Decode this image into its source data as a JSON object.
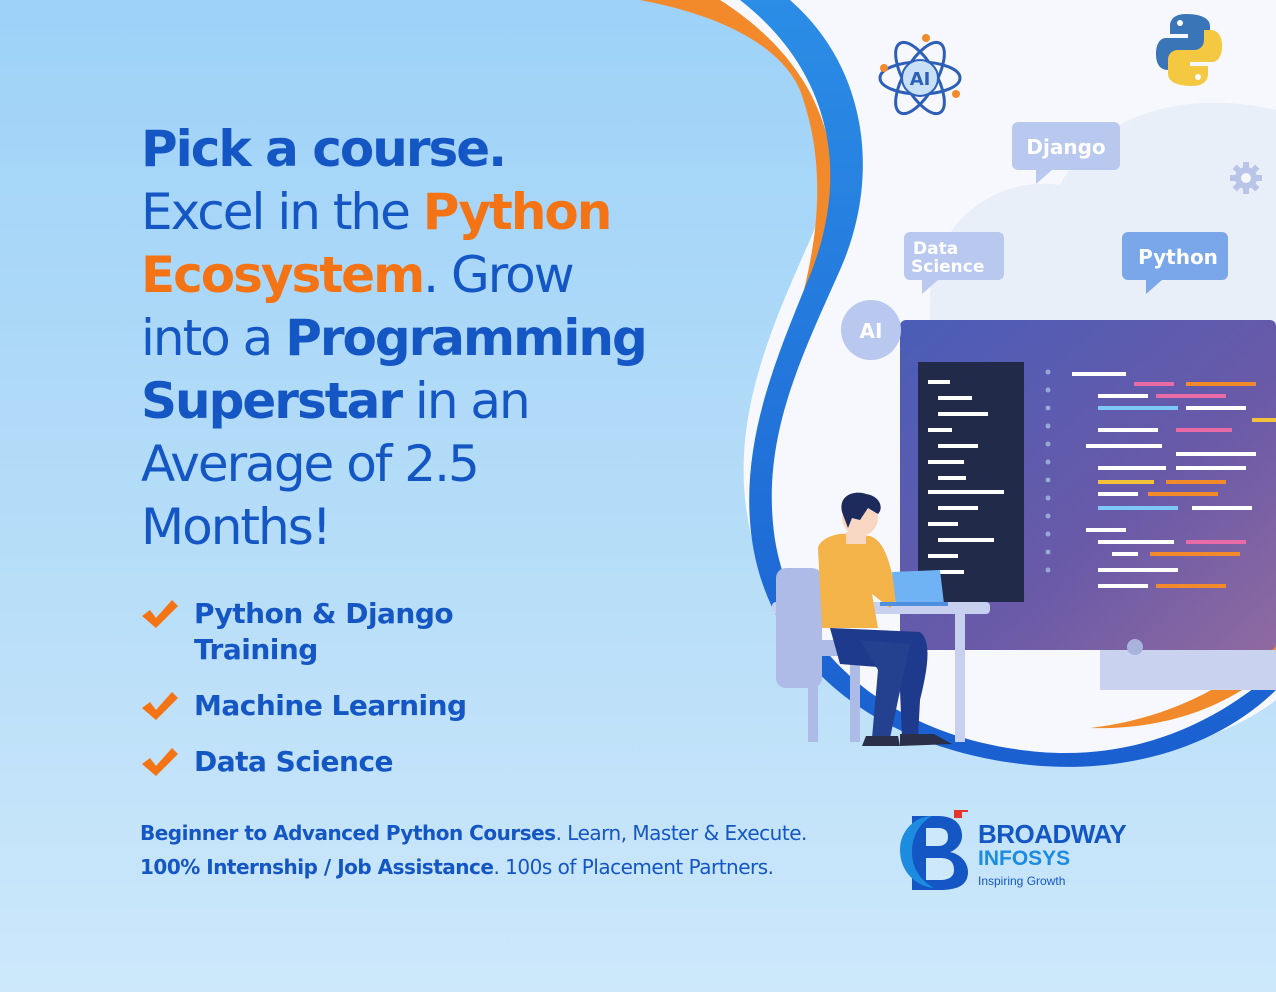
{
  "headline": {
    "line1": "Pick a course.",
    "line2_pre": "Excel in the ",
    "line2_highlight": "Python",
    "line3_highlight": "Ecosystem",
    "line3_post": ". Grow",
    "line4_pre": "into a ",
    "line4_bold": "Programming",
    "line5_bold": "Superstar",
    "line5_post": " in an",
    "line6": "Average of 2.5",
    "line7": "Months!"
  },
  "features": [
    "Python & Django Training",
    "Machine Learning",
    "Data Science"
  ],
  "footer": {
    "line1_bold": "Beginner to Advanced Python Courses",
    "line1_rest": ". Learn, Master & Execute.",
    "line2_bold": "100% Internship / Job Assistance",
    "line2_rest": ". 100s of Placement Partners."
  },
  "logo": {
    "name": "BROADWAY",
    "sub": "INFOSYS",
    "tagline": "Inspiring Growth"
  },
  "bubbles": {
    "ai_atom": "AI",
    "django": "Django",
    "data_science_1": "Data",
    "data_science_2": "Science",
    "python": "Python",
    "ai_circle": "AI"
  },
  "colors": {
    "primary_blue": "#1456c4",
    "accent_orange": "#f47314",
    "background": "#9ed2f8"
  }
}
